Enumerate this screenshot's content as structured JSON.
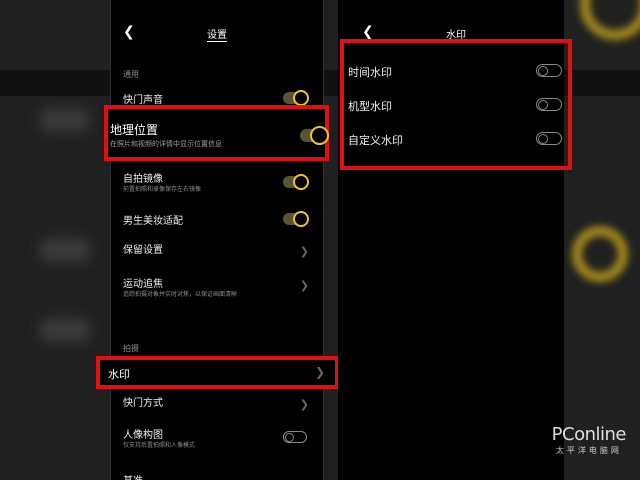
{
  "left_screen": {
    "back_icon": "chevron-left-icon",
    "title": "设置",
    "section_general": "通用",
    "items": [
      {
        "label": "快门声音",
        "toggle": "on"
      },
      {
        "label": "地理位置",
        "sub": "在照片和视频的详情中显示位置信息",
        "toggle": "on"
      },
      {
        "label": "自拍镜像",
        "sub": "前置拍照和录像保存左右镜像",
        "toggle": "on"
      },
      {
        "label": "男生美妆适配",
        "toggle": "on"
      },
      {
        "label": "保留设置",
        "chevron": "chevron-right-icon"
      },
      {
        "label": "运动追焦",
        "sub": "追踪拍摄对象并实时对焦，以保证画面清晰",
        "chevron": "chevron-right-icon"
      }
    ],
    "section_shoot": "拍摄",
    "items2": [
      {
        "label": "水印",
        "chevron": "chevron-right-icon"
      },
      {
        "label": "快门方式",
        "chevron": "chevron-right-icon"
      },
      {
        "label": "人像构图",
        "sub": "仅支持后置拍照和人像模式",
        "toggle": "off"
      },
      {
        "label": "基准"
      }
    ]
  },
  "popout_location": {
    "label": "地理位置",
    "sub": "在照片和视频的详情中显示位置信息"
  },
  "popout_watermark": {
    "label": "水印"
  },
  "right_screen": {
    "back_icon": "chevron-left-icon",
    "title": "水印",
    "items": [
      {
        "label": "时间水印",
        "toggle": "off"
      },
      {
        "label": "机型水印",
        "toggle": "off"
      },
      {
        "label": "自定义水印",
        "toggle": "off"
      }
    ]
  },
  "watermark": {
    "brand": "PConline",
    "sub": "太平洋电脑网"
  },
  "colors": {
    "highlight": "#e01010",
    "toggle_accent": "#f0c420",
    "background": "#000000"
  }
}
